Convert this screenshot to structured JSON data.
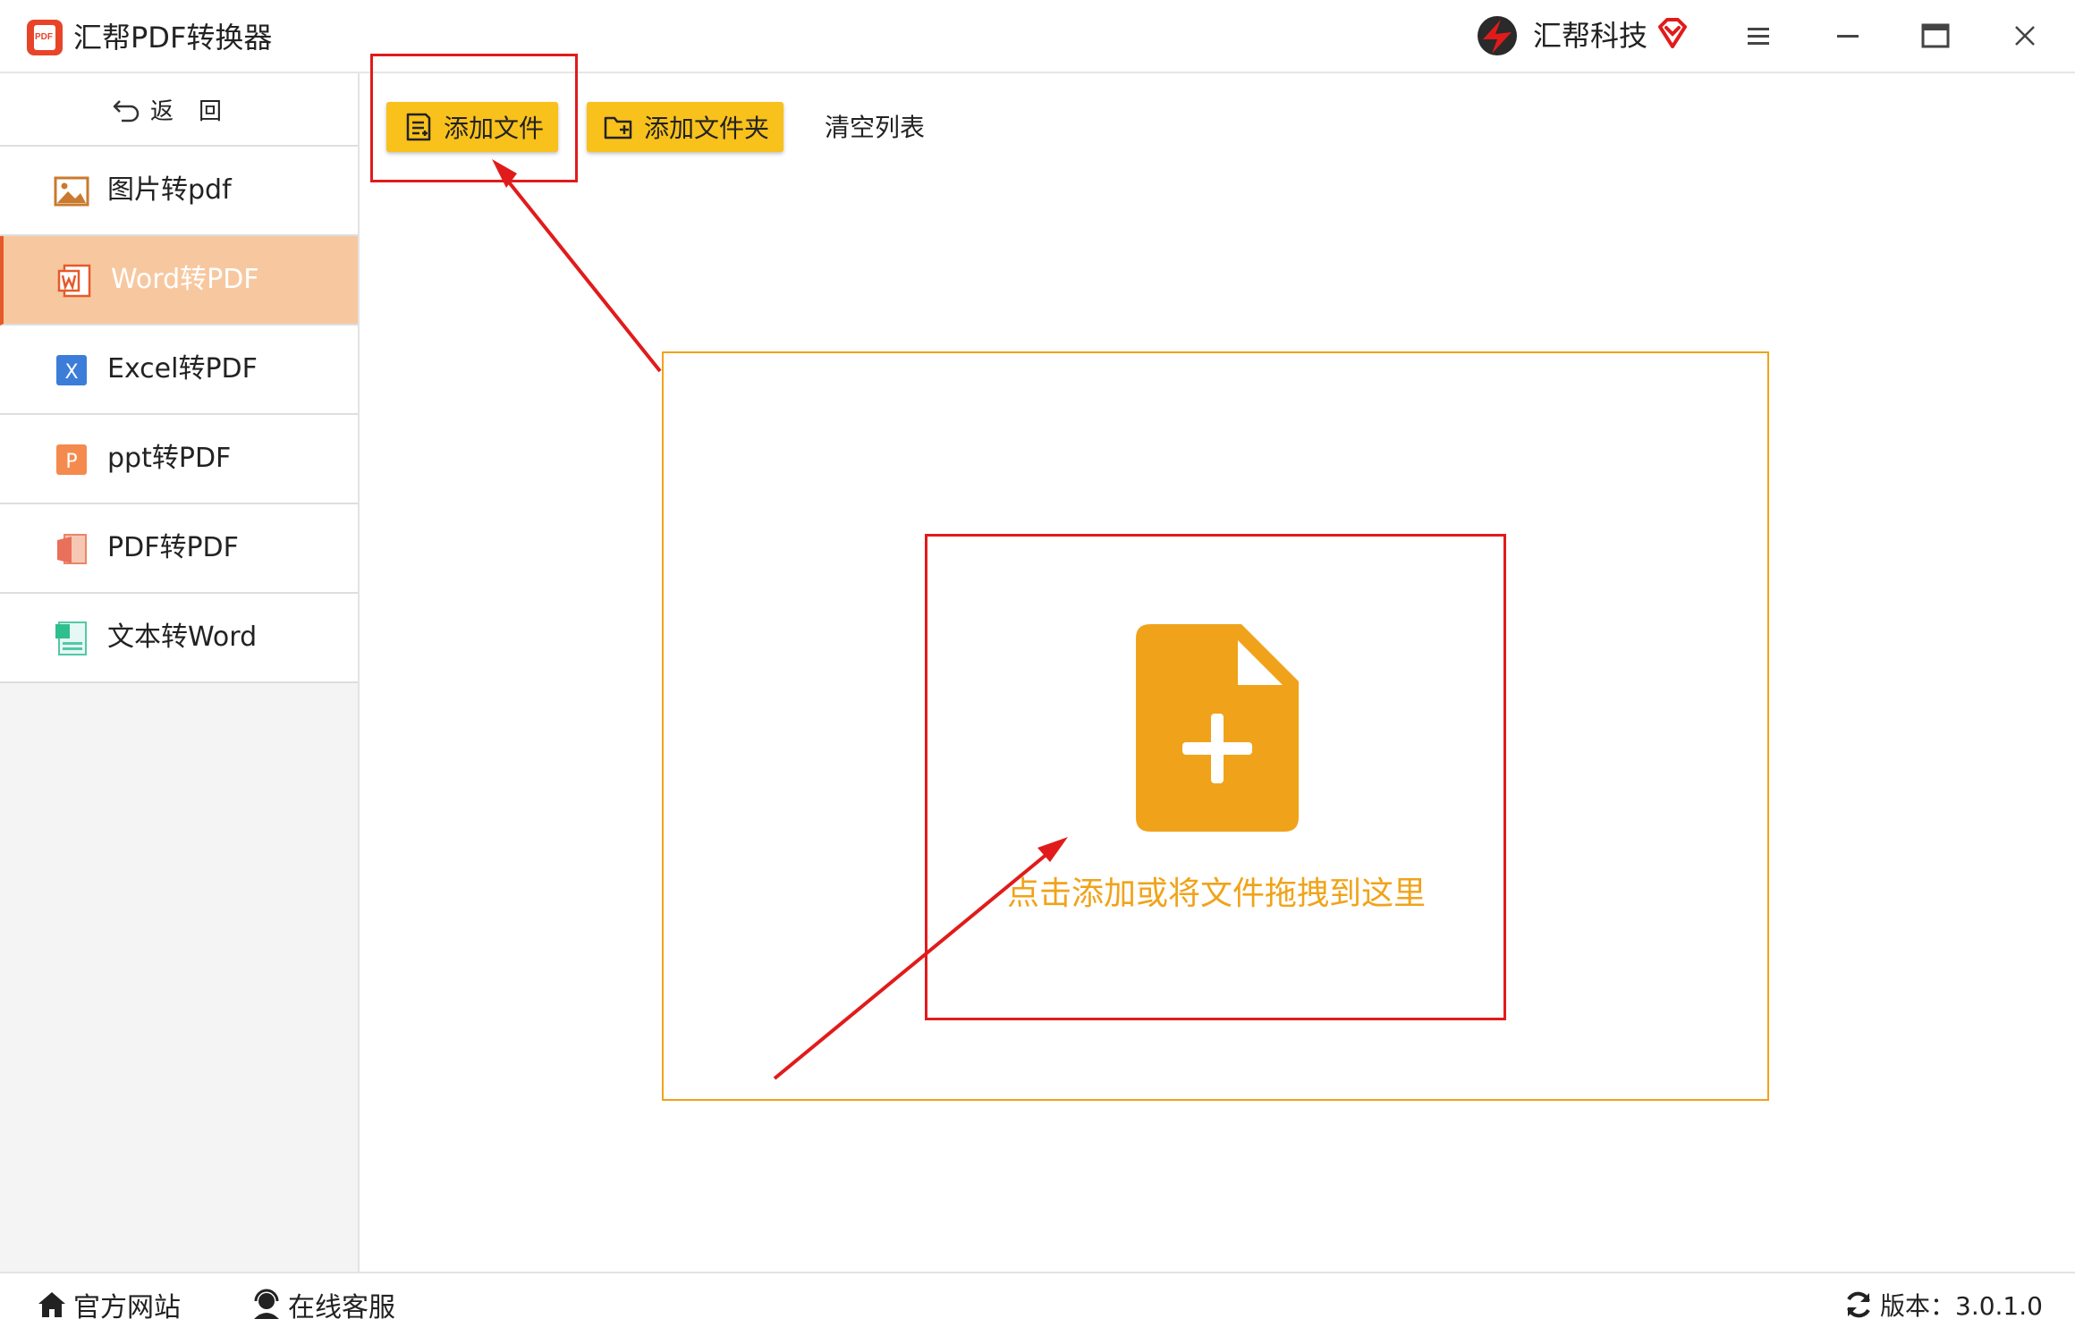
{
  "app": {
    "title": "汇帮PDF转换器",
    "logo_text": "PDF",
    "brand_name": "汇帮科技"
  },
  "sidebar": {
    "back_label": "返回",
    "items": [
      {
        "label": "图片转pdf",
        "icon": "image-icon",
        "active": false
      },
      {
        "label": "Word转PDF",
        "icon": "word-icon",
        "active": true
      },
      {
        "label": "Excel转PDF",
        "icon": "excel-icon",
        "active": false
      },
      {
        "label": "ppt转PDF",
        "icon": "ppt-icon",
        "active": false
      },
      {
        "label": "PDF转PDF",
        "icon": "pdf-icon",
        "active": false
      },
      {
        "label": "文本转Word",
        "icon": "text-icon",
        "active": false
      }
    ],
    "icon_letters": {
      "excel": "X",
      "ppt": "P"
    }
  },
  "toolbar": {
    "add_file_label": "添加文件",
    "add_folder_label": "添加文件夹",
    "clear_list_label": "清空列表"
  },
  "drop_zone": {
    "hint": "点击添加或将文件拖拽到这里"
  },
  "footer": {
    "site_label": "官方网站",
    "service_label": "在线客服",
    "version_label": "版本：3.0.1.0"
  },
  "colors": {
    "accent": "#f8c11b",
    "drop_border": "#f0a31a",
    "active_nav": "#f7c8a0",
    "annotation": "#e11b1b"
  }
}
